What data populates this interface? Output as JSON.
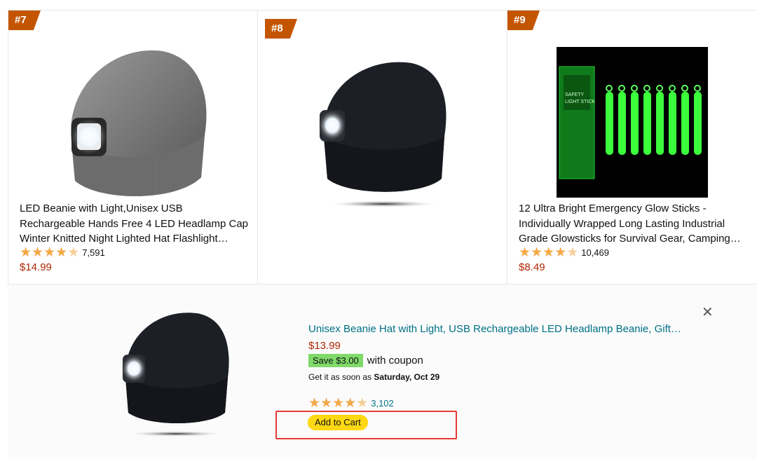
{
  "products": [
    {
      "rank": "#7",
      "title": "LED Beanie with Light,Unisex USB Rechargeable Hands Free 4 LED Headlamp Cap Winter Knitted Night Lighted Hat Flashlight…",
      "rating": 4.5,
      "rating_count": "7,591",
      "price": "$14.99",
      "image": "gray-led-beanie"
    },
    {
      "rank": "#8",
      "title": "",
      "rating": null,
      "rating_count": "",
      "price": "",
      "image": "black-led-beanie"
    },
    {
      "rank": "#9",
      "title": "12 Ultra Bright Emergency Glow Sticks - Individually Wrapped Long Lasting Industrial Grade Glowsticks for Survival Gear, Camping…",
      "rating": 4.5,
      "rating_count": "10,469",
      "price": "$8.49",
      "image": "green-glow-sticks-box",
      "box_text": [
        "SAFETY",
        "LIGHT STICK"
      ]
    }
  ],
  "popover": {
    "title": "Unisex Beanie Hat with Light, USB Rechargeable LED Headlamp Beanie, Gift…",
    "price": "$13.99",
    "coupon_badge": "Save $3.00",
    "coupon_text": "with coupon",
    "delivery_prefix": "Get it as soon as ",
    "delivery_date": "Saturday, Oct 29",
    "rating": 4.5,
    "rating_count": "3,102",
    "add_to_cart": "Add to Cart",
    "close_icon": "close-icon",
    "image": "black-led-beanie"
  },
  "colors": {
    "badge": "#c45500",
    "price": "#b12704",
    "link": "#007185",
    "star": "#f3a847",
    "cart_button": "#ffd814",
    "coupon": "#7fda69",
    "highlight_box": "#e53935"
  }
}
